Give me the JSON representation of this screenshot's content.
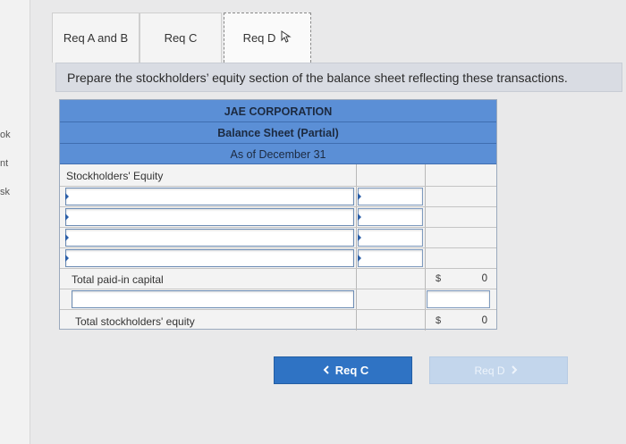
{
  "sidebar": {
    "items": [
      "ok",
      "nt",
      "sk"
    ]
  },
  "tabs": [
    {
      "label": "Req A and B"
    },
    {
      "label": "Req C"
    },
    {
      "label": "Req D"
    }
  ],
  "instruction": "Prepare the stockholders’ equity section of the balance sheet reflecting these transactions.",
  "sheet": {
    "company": "JAE CORPORATION",
    "statement": "Balance Sheet (Partial)",
    "date": "As of December 31",
    "section_label": "Stockholders' Equity",
    "total_paid_in_label": "Total paid-in capital",
    "total_se_label": "Total stockholders' equity",
    "currency_symbol": "$",
    "total_paid_in_value": "0",
    "total_se_value": "0"
  },
  "nav": {
    "prev_label": "Req C",
    "next_label": "Req D",
    "prev_icon": "chevron-left-icon",
    "next_icon": "chevron-right-icon"
  },
  "colors": {
    "header_blue": "#5b8fd6",
    "button_blue": "#2f73c4",
    "button_disabled": "#c3d6ec"
  }
}
